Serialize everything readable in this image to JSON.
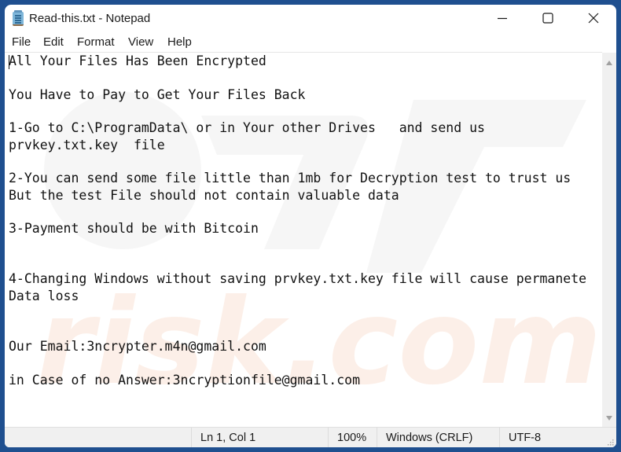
{
  "window": {
    "title": "Read-this.txt - Notepad",
    "app_icon": "notepad-icon",
    "controls": {
      "minimize": "minimize-icon",
      "maximize": "maximize-icon",
      "close": "close-icon"
    }
  },
  "menu": {
    "items": [
      {
        "label": "File"
      },
      {
        "label": "Edit"
      },
      {
        "label": "Format"
      },
      {
        "label": "View"
      },
      {
        "label": "Help"
      }
    ]
  },
  "editor": {
    "content": "All Your Files Has Been Encrypted\n\nYou Have to Pay to Get Your Files Back\n\n1-Go to C:\\ProgramData\\ or in Your other Drives   and send us\nprvkey.txt.key  file\n\n2-You can send some file little than 1mb for Decryption test to trust us\nBut the test File should not contain valuable data\n\n3-Payment should be with Bitcoin\n\n\n4-Changing Windows without saving prvkey.txt.key file will cause permanete\nData loss\n\n\nOur Email:3ncrypter.m4n@gmail.com\n\nin Case of no Answer:3ncryptionfile@gmail.com",
    "watermark": "pcrisk.com"
  },
  "statusbar": {
    "position": "Ln 1, Col 1",
    "zoom": "100%",
    "line_ending": "Windows (CRLF)",
    "encoding": "UTF-8"
  },
  "colors": {
    "desktop": "#1f4f8f",
    "watermark_gray": "#ebebeb",
    "watermark_orange": "#fbe9e0"
  }
}
